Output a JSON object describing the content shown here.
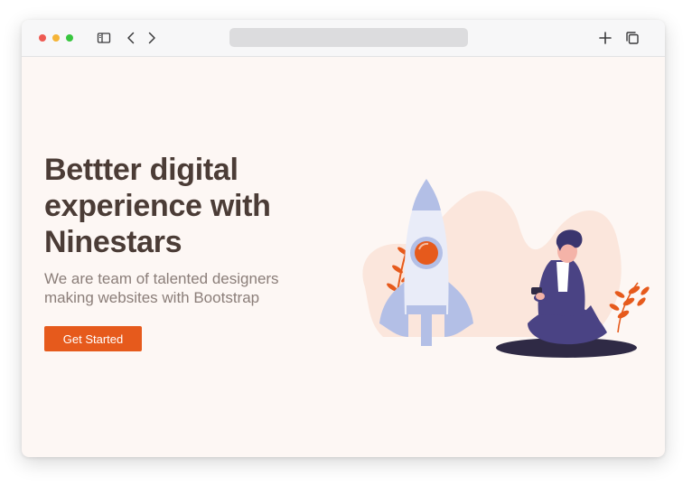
{
  "browser": {
    "window_buttons": [
      "close",
      "minimize",
      "zoom"
    ],
    "icons": {
      "sidebar": "sidebar-toggle-icon",
      "back": "chevron-left-icon",
      "forward": "chevron-right-icon",
      "new_tab": "plus-icon",
      "tabs": "tabs-overview-icon"
    },
    "address_value": ""
  },
  "hero": {
    "title": "Bettter digital experience with Ninestars",
    "subtitle": "We are team of talented designers making websites with Bootstrap",
    "cta_label": "Get Started"
  },
  "illustration": {
    "description_icon": "rocket-launch-illustration"
  },
  "colors": {
    "accent": "#e65a1c",
    "heading": "#4b3c36",
    "subtitle": "#8b7e79",
    "page_background": "#fdf7f4",
    "rocket": "#b3bfe6",
    "person": "#4a4384"
  }
}
